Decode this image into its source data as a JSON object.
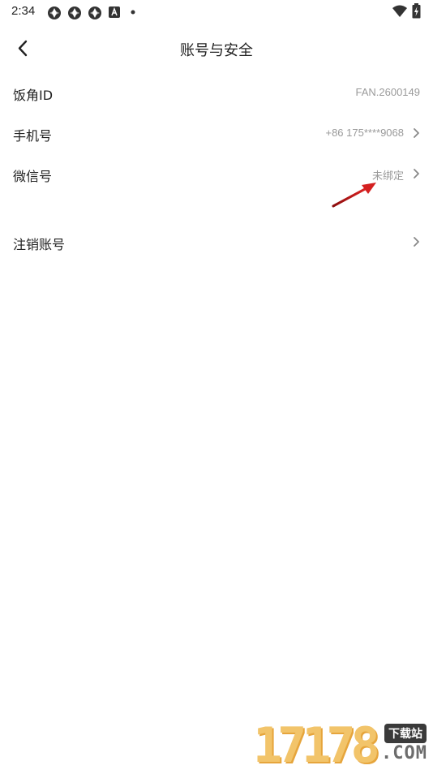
{
  "status_bar": {
    "time": "2:34",
    "notification_icons": [
      "app-icon",
      "app-icon",
      "app-icon",
      "a-badge-icon",
      "dot-icon"
    ],
    "right_icons": [
      "wifi-icon",
      "battery-icon"
    ]
  },
  "header": {
    "title": "账号与安全",
    "back_icon": "chevron-left-icon"
  },
  "rows": [
    {
      "label": "饭角ID",
      "value": "FAN.2600149",
      "has_arrow": false
    },
    {
      "label": "手机号",
      "value": "+86 175****9068",
      "has_arrow": true
    },
    {
      "label": "微信号",
      "value": "未绑定",
      "has_arrow": true
    },
    {
      "label": "注销账号",
      "value": "",
      "has_arrow": true
    }
  ],
  "colors": {
    "text_primary": "#222222",
    "text_secondary": "#9a9a9a",
    "annotation_arrow": "#d42020"
  },
  "watermark": {
    "digits": "17178",
    "badge": "下载站",
    "suffix": ".COM"
  }
}
